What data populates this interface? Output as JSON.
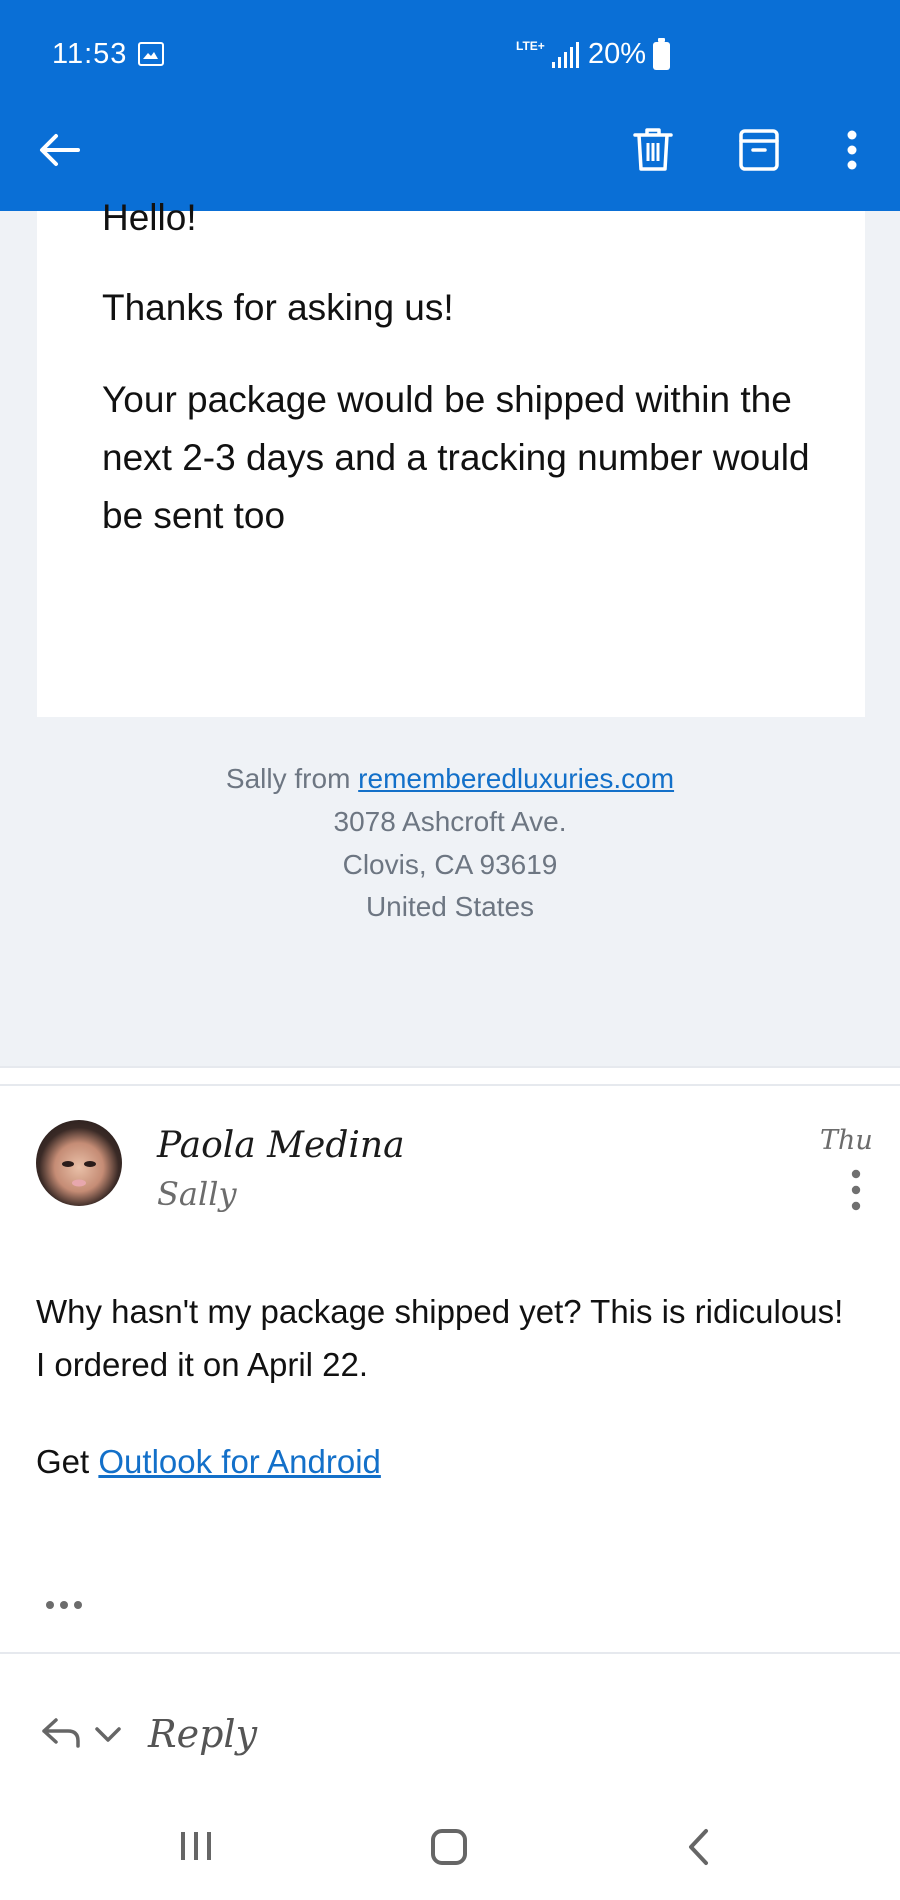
{
  "status_bar": {
    "time": "11:53",
    "network": "LTE+",
    "battery_percent": "20%",
    "icons": [
      "gallery-icon",
      "signal-icon",
      "battery-icon"
    ]
  },
  "toolbar": {
    "icons": [
      "back-arrow-icon",
      "trash-icon",
      "archive-icon",
      "more-vertical-icon"
    ],
    "accent_color": "#0a6fd6"
  },
  "email_card": {
    "greeting": "Hello!",
    "line1": "Thanks for asking us!",
    "line2": "Your package would be shipped within the next 2-3 days and a tracking number would be sent too"
  },
  "email_footer": {
    "from_prefix": "Sally from",
    "link": "rememberedluxuries.com",
    "address1": "3078 Ashcroft Ave.",
    "address2": "Clovis, CA 93619",
    "country": "United States"
  },
  "message": {
    "sender": "Paola Medina",
    "recipient": "Sally",
    "date": "Thu",
    "body": "Why hasn't my package shipped yet? This is ridiculous! I ordered it on April 22.",
    "signature_prefix": "Get",
    "signature_link": "Outlook for Android",
    "more_label": "•••"
  },
  "reply_bar": {
    "label": "Reply",
    "icons": [
      "reply-arrow-icon",
      "chevron-down-icon"
    ]
  },
  "nav_bar": {
    "icons": [
      "recents-icon",
      "home-icon",
      "back-icon"
    ]
  }
}
